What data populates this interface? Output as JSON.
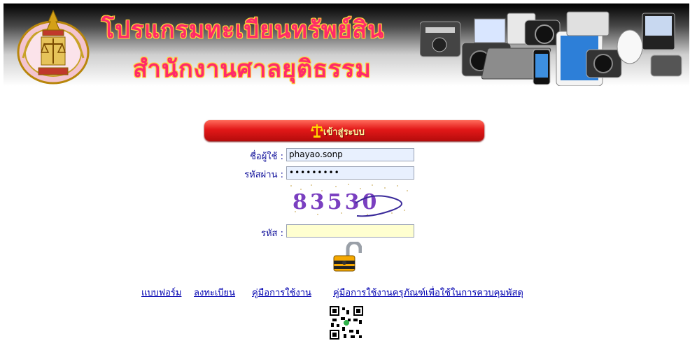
{
  "banner": {
    "title_line1": "โปรแกรมทะเบียนทรัพย์สิน",
    "title_line2": "สำนักงานศาลยุติธรรม"
  },
  "login": {
    "header": "เข้าสู่ระบบ",
    "username_label": "ชื่อผู้ใช้ :",
    "username_value": "phayao.sonp",
    "password_label": "รหัสผ่าน :",
    "password_value": "•••••••••",
    "captcha_text": "83530",
    "code_label": "รหัส :",
    "code_value": ""
  },
  "links": {
    "form": "แบบฟอร์ม",
    "register": "ลงทะเบียน",
    "manual": "คู่มือการใช้งาน",
    "equipment_manual": "คู่มือการใช้งานครุภัณฑ์เพื่อใช้ในการควบคุมพัสดุ"
  },
  "colors": {
    "title": "#ff2a6a",
    "title_outline": "#ffd23a",
    "login_bar": "#d81414",
    "label_text": "#10109a",
    "link": "#0000b0",
    "code_field_bg": "#ffffd0",
    "input_bg": "#e8f0fe"
  }
}
